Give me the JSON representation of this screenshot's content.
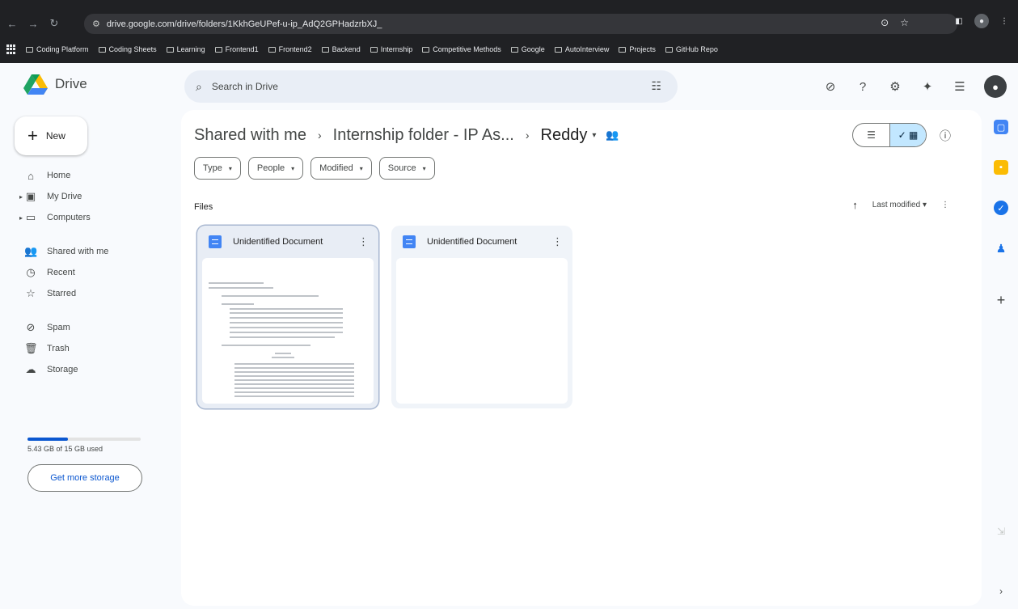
{
  "browser": {
    "url": "drive.google.com/drive/folders/1KkhGeUPef-u-ip_AdQ2GPHadzrbXJ_",
    "bookmarks": [
      "Coding Platform",
      "Coding Sheets",
      "Learning",
      "Frontend1",
      "Frontend2",
      "Backend",
      "Internship",
      "Competitive Methods",
      "Google",
      "AutoInterview",
      "Projects",
      "GitHub Repo"
    ]
  },
  "app": {
    "name": "Drive",
    "search_placeholder": "Search in Drive",
    "new_label": "New",
    "nav": [
      {
        "label": "Home",
        "icon": "home-icon"
      },
      {
        "label": "My Drive",
        "icon": "my-drive-icon"
      },
      {
        "label": "Computers",
        "icon": "computer-icon"
      },
      {
        "label": "Shared with me",
        "icon": "people-icon"
      },
      {
        "label": "Recent",
        "icon": "clock-icon"
      },
      {
        "label": "Starred",
        "icon": "star-icon"
      },
      {
        "label": "Spam",
        "icon": "spam-icon"
      },
      {
        "label": "Trash",
        "icon": "trash-icon"
      },
      {
        "label": "Storage",
        "icon": "cloud-icon"
      }
    ],
    "storage": {
      "used_text": "5.43 GB of 15 GB used",
      "used_fraction": 0.36,
      "button_label": "Get more storage"
    }
  },
  "main": {
    "breadcrumb": [
      "Shared with me",
      "Internship folder - IP As...",
      "Reddy"
    ],
    "filters": [
      "Type",
      "People",
      "Modified",
      "Source"
    ],
    "files_label": "Files",
    "sort_label": "Last modified",
    "files": [
      {
        "title": "Unidentified Document",
        "selected": true,
        "has_preview": true
      },
      {
        "title": "Unidentified Document",
        "selected": false,
        "has_preview": false
      }
    ]
  },
  "colors": {
    "accent": "#0b57d0",
    "toggle_active": "#c2e7ff",
    "doc_blue": "#4285f4"
  }
}
